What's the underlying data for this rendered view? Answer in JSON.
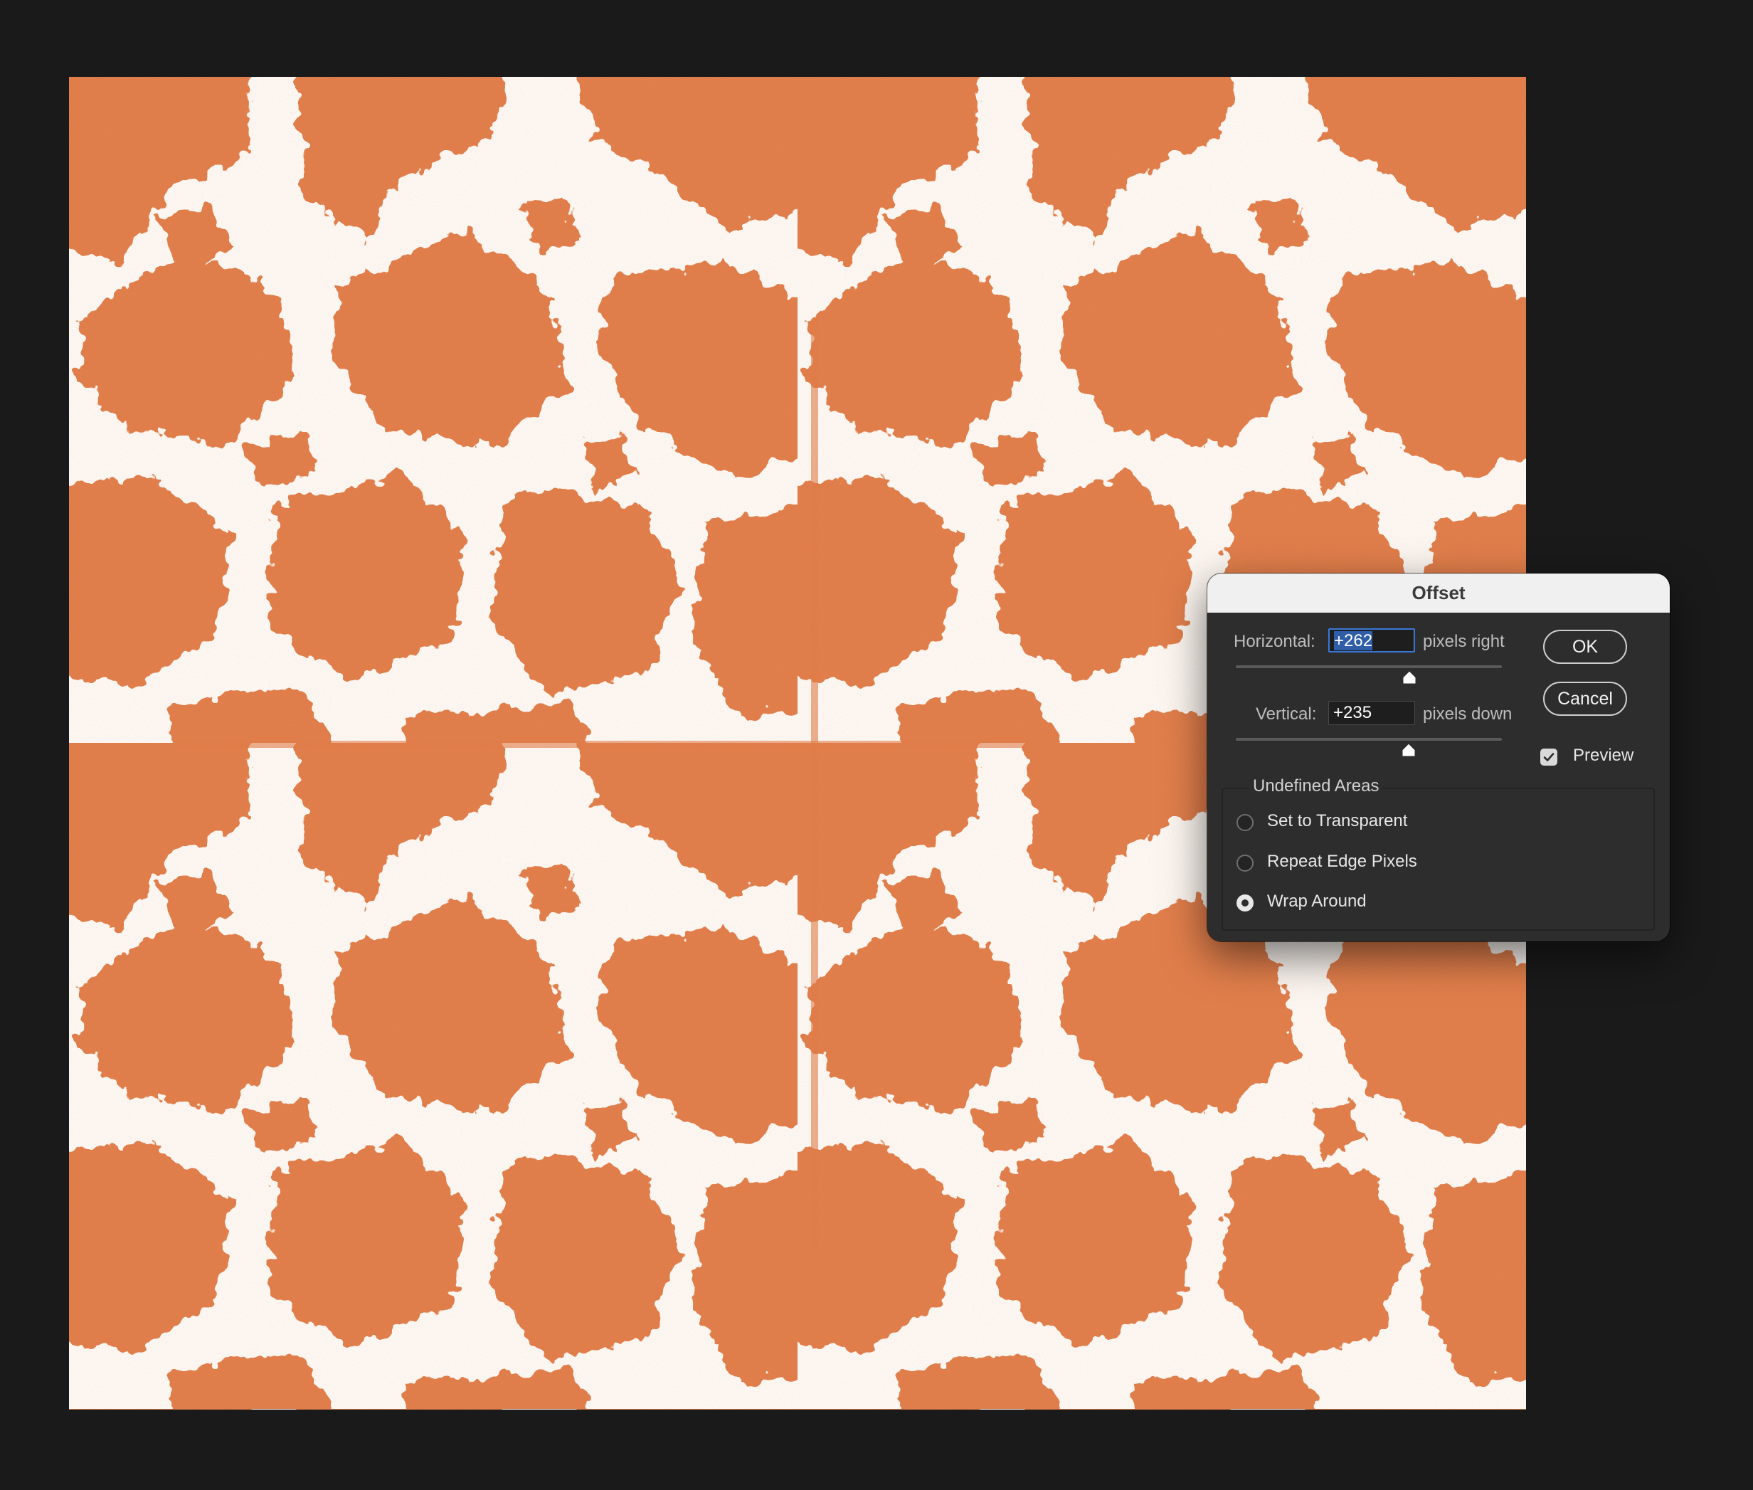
{
  "dialog": {
    "title": "Offset",
    "horizontal": {
      "label": "Horizontal:",
      "value": "+262",
      "unit": "pixels right"
    },
    "vertical": {
      "label": "Vertical:",
      "value": "+235",
      "unit": "pixels down"
    },
    "ok_label": "OK",
    "cancel_label": "Cancel",
    "preview": {
      "label": "Preview",
      "checked": true
    },
    "undefined_areas": {
      "legend": "Undefined Areas",
      "options": [
        {
          "label": "Set to Transparent",
          "selected": false
        },
        {
          "label": "Repeat Edge Pixels",
          "selected": false
        },
        {
          "label": "Wrap Around",
          "selected": true
        }
      ]
    }
  },
  "colors": {
    "app_background": "#1a1a1a",
    "pattern_orange": "#e07c48",
    "pattern_light": "#fdf9f6",
    "dialog_background": "#2d2d2d",
    "title_bar": "#f0f0f0",
    "focus_blue": "#3a78d8"
  }
}
